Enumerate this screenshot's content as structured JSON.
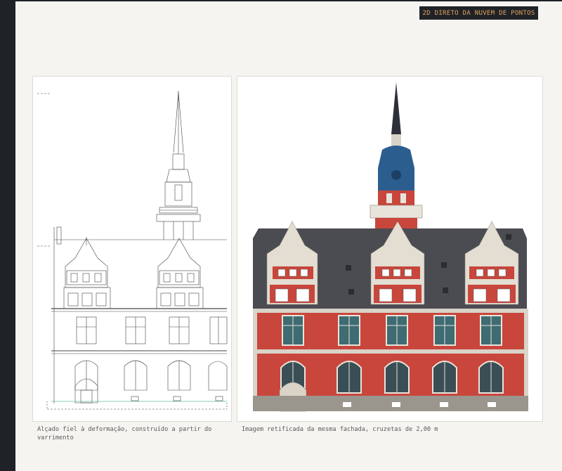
{
  "badge": {
    "label": "2D DIRETO DA NUVEM DE PONTOS",
    "text_color": "#e3a35c",
    "bg_color": "#1f2328"
  },
  "panels": {
    "left": {
      "caption": "Alçado fiel à deformação, construído a partir do varrimento"
    },
    "right": {
      "caption": "Imagem retificada da mesma fachada, cruzetas de 2,00 m"
    }
  },
  "colors": {
    "facade_red": "#c8463c",
    "roof_slate": "#4a4c52",
    "dome_blue": "#2c5d8f",
    "stone": "#d9d3c8",
    "background": "#f5f4f0",
    "sidebar": "#1f2328"
  }
}
